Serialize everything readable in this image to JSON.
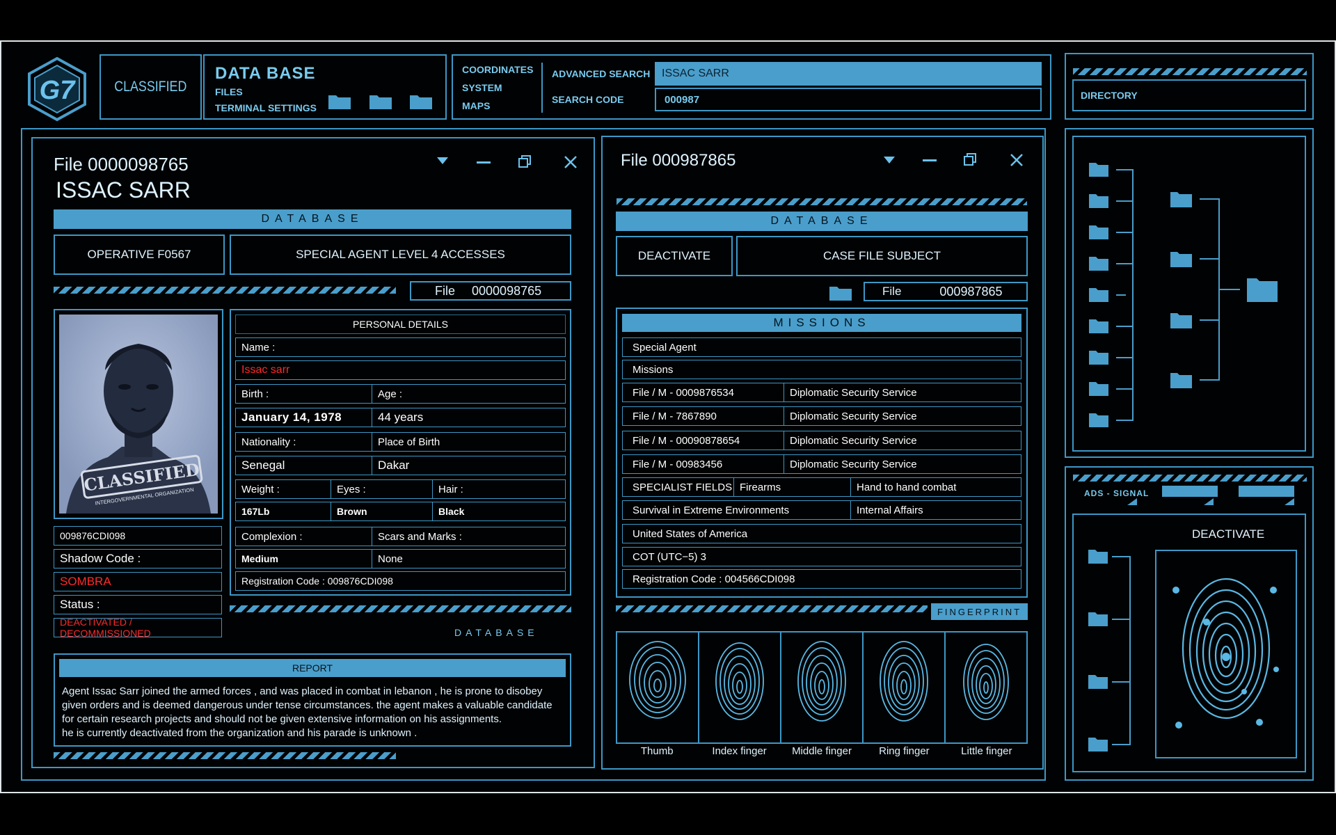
{
  "header": {
    "logo_text": "G7",
    "classified": "CLASSIFIED",
    "db_title": "DATA BASE",
    "db_files": "FILES",
    "db_terminal": "TERMINAL SETTINGS",
    "nav": [
      "COORDINATES",
      "SYSTEM",
      "MAPS"
    ],
    "advanced_search_label": "ADVANCED SEARCH",
    "advanced_search_value": "ISSAC SARR",
    "search_code_label": "SEARCH CODE",
    "search_code_value": "000987",
    "directory": "DIRECTORY"
  },
  "left_panel": {
    "file_title": "File 0000098765",
    "name_title": "ISSAC SARR",
    "database_bar": "DATABASE",
    "operative": "OPERATIVE F0567",
    "access": "SPECIAL AGENT LEVEL 4 ACCESSES",
    "file_label": "File",
    "file_num": "0000098765",
    "photo_stamp": "CLASSIFIED",
    "photo_stamp_sub": "INTERGOVERNMENTAL ORGANIZATION",
    "id_code": "009876CDI098",
    "shadow_label": "Shadow Code :",
    "shadow_value": "SOMBRA",
    "status_label": "Status :",
    "status_value": "DEACTIVATED / DECOMMISSIONED",
    "personal_details": "PERSONAL DETAILS",
    "name_label": "Name :",
    "name_value": "Issac sarr",
    "birth_label": "Birth :",
    "age_label": "Age :",
    "birth_value": "January 14, 1978",
    "age_value": "44 years",
    "nationality_label": "Nationality :",
    "pob_label": "Place of Birth",
    "nationality_value": "Senegal",
    "pob_value": "Dakar",
    "weight_label": "Weight :",
    "eyes_label": "Eyes :",
    "hair_label": "Hair :",
    "weight_value": "167Lb",
    "eyes_value": "Brown",
    "hair_value": "Black",
    "complexion_label": "Complexion :",
    "scars_label": "Scars and Marks :",
    "complexion_value": "Medium",
    "scars_value": "None",
    "registration": "Registration Code : 009876CDI098",
    "database_small": "DATABASE",
    "report_title": "REPORT",
    "report_lines": [
      "Agent Issac Sarr  joined the armed forces , and was placed in combat in lebanon , he  is prone to disobey",
      "given orders and is deemed dangerous under tense circumstances. the agent makes a valuable candidate",
      "for certain research projects and should not be given extensive information on his assignments.",
      "he is currently deactivated from the organization and his parade is unknown  ."
    ]
  },
  "right_panel": {
    "file_title": "File 000987865",
    "database_bar": "DATABASE",
    "deactivate": "DEACTIVATE",
    "case_file": "CASE FILE SUBJECT",
    "file_label": "File",
    "file_num": "000987865",
    "missions_title": "MISSIONS",
    "special_agent": "Special Agent",
    "missions": "Missions",
    "mission_rows": [
      {
        "file": "File / M - 0009876534",
        "service": "Diplomatic Security Service"
      },
      {
        "file": "File / M - 7867890",
        "service": "Diplomatic Security Service"
      },
      {
        "file": "File / M - 00090878654",
        "service": "Diplomatic Security Service"
      },
      {
        "file": "File / M - 00983456",
        "service": "Diplomatic Security Service"
      }
    ],
    "specialist_label": "SPECIALIST FIELDS",
    "firearms": "Firearms",
    "hand_combat": "Hand to hand combat",
    "survival": "Survival in Extreme Environments",
    "internal_affairs": "Internal Affairs",
    "country": "United States of America",
    "timezone": "COT (UTC−5) 3",
    "registration": "Registration Code : 004566CDI098",
    "fingerprint_label": "FINGERPRINT",
    "fingers": [
      "Thumb",
      "Index finger",
      "Middle finger",
      "Ring finger",
      "Little finger"
    ]
  },
  "sidebar": {
    "ads_signal": "ADS - SIGNAL",
    "deactivate": "DEACTIVATE"
  },
  "colors": {
    "accent": "#4a9ecb",
    "border": "#3d98c7",
    "text_light": "#6cc2ec",
    "alert": "#ff2a2a",
    "background": "#000000"
  },
  "icons": [
    "logo-icon",
    "folder-icon",
    "dropdown-icon",
    "minimize-icon",
    "restore-icon",
    "close-icon",
    "fingerprint-icon"
  ]
}
